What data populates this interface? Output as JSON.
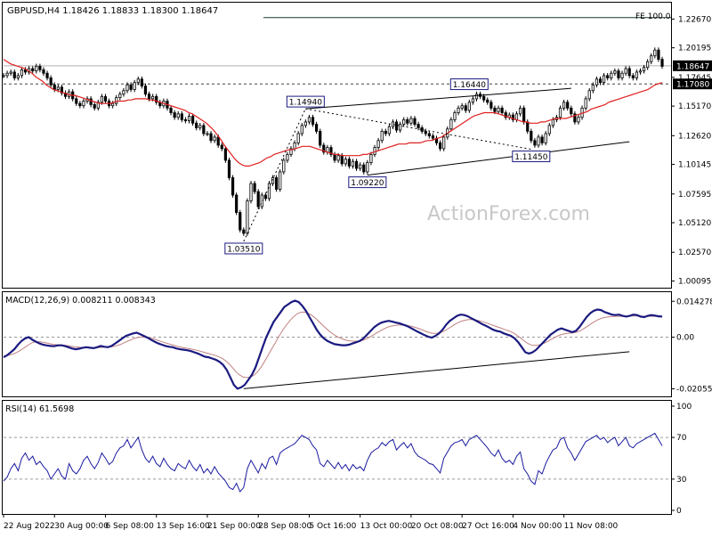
{
  "chart_data": {
    "type": "candlestick",
    "header": "GBPUSD,H4  1.18426 1.18833 1.18300 1.18647",
    "watermark": "ActionForex.com",
    "fe_label": "FE 100.0",
    "price_axis": {
      "ticks": [
        "1.22670",
        "1.20195",
        "1.17645",
        "1.15170",
        "1.12620",
        "1.10145",
        "1.07595",
        "1.05120",
        "1.02570",
        "1.00095"
      ],
      "tick_values": [
        1.2267,
        1.20195,
        1.17645,
        1.1517,
        1.1262,
        1.10145,
        1.07595,
        1.0512,
        1.0257,
        1.00095
      ],
      "current_price_label": "1.18647",
      "current_price": 1.18647,
      "support_label": "1.17080",
      "support_price": 1.1708,
      "fe_level": 1.228,
      "ylim": [
        0.999,
        1.237
      ]
    },
    "annotations": [
      {
        "label": "1.03510",
        "price": 1.0351,
        "bar": 66
      },
      {
        "label": "1.14940",
        "price": 1.1494,
        "bar": 83
      },
      {
        "label": "1.09220",
        "price": 1.0922,
        "bar": 100
      },
      {
        "label": "1.16440",
        "price": 1.1644,
        "bar": 128
      },
      {
        "label": "1.11450",
        "price": 1.1145,
        "bar": 145
      }
    ],
    "x_axis": {
      "labels": [
        "22 Aug 2022",
        "30 Aug 00:00",
        "6 Sep 08:00",
        "13 Sep 16:00",
        "21 Sep 00:00",
        "28 Sep 08:00",
        "5 Oct 16:00",
        "13 Oct 00:00",
        "20 Oct 08:00",
        "27 Oct 16:00",
        "4 Nov 00:00",
        "11 Nov 08:00"
      ],
      "label_bars": [
        0,
        14,
        28,
        42,
        56,
        70,
        84,
        98,
        112,
        126,
        140,
        154
      ]
    },
    "candles_close": [
      1.178,
      1.18,
      1.181,
      1.176,
      1.178,
      1.183,
      1.181,
      1.184,
      1.182,
      1.186,
      1.183,
      1.18,
      1.176,
      1.17,
      1.166,
      1.168,
      1.163,
      1.16,
      1.164,
      1.158,
      1.154,
      1.152,
      1.156,
      1.158,
      1.153,
      1.15,
      1.155,
      1.16,
      1.156,
      1.152,
      1.154,
      1.159,
      1.162,
      1.165,
      1.17,
      1.166,
      1.172,
      1.175,
      1.169,
      1.162,
      1.158,
      1.16,
      1.155,
      1.152,
      1.156,
      1.15,
      1.146,
      1.142,
      1.145,
      1.14,
      1.139,
      1.143,
      1.137,
      1.133,
      1.135,
      1.128,
      1.128,
      1.122,
      1.125,
      1.118,
      1.115,
      1.105,
      1.09,
      1.075,
      1.06,
      1.045,
      1.042,
      1.07,
      1.085,
      1.078,
      1.065,
      1.075,
      1.072,
      1.085,
      1.09,
      1.08,
      1.095,
      1.105,
      1.11,
      1.115,
      1.12,
      1.128,
      1.135,
      1.138,
      1.142,
      1.136,
      1.13,
      1.118,
      1.112,
      1.116,
      1.11,
      1.105,
      1.109,
      1.102,
      1.106,
      1.1,
      1.104,
      1.098,
      1.101,
      1.095,
      1.103,
      1.11,
      1.116,
      1.122,
      1.13,
      1.128,
      1.134,
      1.138,
      1.131,
      1.136,
      1.14,
      1.137,
      1.141,
      1.136,
      1.133,
      1.13,
      1.128,
      1.126,
      1.124,
      1.12,
      1.115,
      1.125,
      1.132,
      1.14,
      1.146,
      1.15,
      1.152,
      1.148,
      1.155,
      1.158,
      1.162,
      1.16,
      1.157,
      1.155,
      1.15,
      1.147,
      1.15,
      1.146,
      1.142,
      1.144,
      1.14,
      1.145,
      1.15,
      1.138,
      1.13,
      1.122,
      1.118,
      1.125,
      1.12,
      1.128,
      1.135,
      1.14,
      1.142,
      1.15,
      1.155,
      1.15,
      1.145,
      1.138,
      1.142,
      1.15,
      1.158,
      1.165,
      1.17,
      1.175,
      1.172,
      1.178,
      1.176,
      1.18,
      1.182,
      1.176,
      1.18,
      1.184,
      1.178,
      1.176,
      1.181,
      1.182,
      1.185,
      1.19,
      1.195,
      1.2,
      1.192,
      1.186
    ],
    "ma_close": [
      1.192,
      1.19,
      1.188,
      1.187,
      1.186,
      1.185,
      1.184,
      1.182,
      1.18,
      1.177,
      1.175,
      1.173,
      1.17,
      1.168,
      1.166,
      1.165,
      1.164,
      1.163,
      1.162,
      1.161,
      1.161,
      1.16,
      1.159,
      1.158,
      1.157,
      1.156,
      1.155,
      1.154,
      1.154,
      1.154,
      1.154,
      1.155,
      1.156,
      1.156,
      1.156,
      1.157,
      1.157,
      1.158,
      1.158,
      1.158,
      1.158,
      1.157,
      1.157,
      1.156,
      1.155,
      1.154,
      1.153,
      1.152,
      1.151,
      1.15,
      1.149,
      1.148,
      1.146,
      1.145,
      1.143,
      1.141,
      1.139,
      1.137,
      1.134,
      1.131,
      1.127,
      1.123,
      1.118,
      1.114,
      1.11,
      1.106,
      1.103,
      1.101,
      1.1,
      1.1,
      1.101,
      1.102,
      1.103,
      1.105,
      1.107,
      1.108,
      1.11,
      1.111,
      1.112,
      1.113,
      1.114,
      1.114,
      1.115,
      1.116,
      1.117,
      1.117,
      1.117,
      1.116,
      1.115,
      1.114,
      1.113,
      1.112,
      1.111,
      1.11,
      1.11,
      1.109,
      1.109,
      1.109,
      1.109,
      1.109,
      1.109,
      1.11,
      1.11,
      1.111,
      1.112,
      1.113,
      1.114,
      1.115,
      1.116,
      1.117,
      1.118,
      1.119,
      1.119,
      1.119,
      1.12,
      1.12,
      1.12,
      1.12,
      1.121,
      1.122,
      1.122,
      1.123,
      1.124,
      1.125,
      1.127,
      1.129,
      1.131,
      1.133,
      1.135,
      1.137,
      1.139,
      1.141,
      1.143,
      1.144,
      1.145,
      1.146,
      1.146,
      1.146,
      1.146,
      1.145,
      1.144,
      1.143,
      1.142,
      1.141,
      1.14,
      1.139,
      1.138,
      1.138,
      1.137,
      1.137,
      1.137,
      1.138,
      1.138,
      1.139,
      1.14,
      1.141,
      1.141,
      1.141,
      1.141,
      1.142,
      1.143,
      1.144,
      1.145,
      1.146,
      1.147,
      1.149,
      1.15,
      1.151,
      1.152,
      1.153,
      1.155,
      1.156,
      1.157,
      1.158,
      1.159,
      1.16,
      1.161,
      1.162,
      1.163,
      1.164,
      1.165,
      1.166,
      1.168,
      1.17,
      1.171,
      1.172
    ],
    "trendlines": [
      {
        "name": "channel-upper",
        "from": {
          "bar": 83,
          "price": 1.1494
        },
        "to": {
          "bar": 156,
          "price": 1.167
        }
      },
      {
        "name": "channel-lower",
        "from": {
          "bar": 100,
          "price": 1.0922
        },
        "to": {
          "bar": 172,
          "price": 1.121
        }
      },
      {
        "name": "retrace-dotted-1",
        "from": {
          "bar": 83,
          "price": 1.1494
        },
        "to": {
          "bar": 145,
          "price": 1.1145
        },
        "dashed": true
      },
      {
        "name": "retrace-dotted-2",
        "from": {
          "bar": 66,
          "price": 1.0351
        },
        "to": {
          "bar": 83,
          "price": 1.1494
        },
        "dashed": true
      }
    ],
    "macd": {
      "label": "MACD(12,26,9) 0.008211 0.008343",
      "ticks": [
        "0.014278",
        "0.00",
        "-0.020556"
      ],
      "tick_values": [
        0.014278,
        0.0,
        -0.020556
      ],
      "ylim": [
        -0.0225,
        0.0165
      ],
      "macd_line": [
        -0.008,
        -0.0072,
        -0.006,
        -0.0048,
        -0.003,
        -0.0015,
        -0.0005,
        0.0,
        -0.001,
        -0.0018,
        -0.0025,
        -0.003,
        -0.0033,
        -0.0035,
        -0.0036,
        -0.0033,
        -0.0032,
        -0.0035,
        -0.004,
        -0.0045,
        -0.0048,
        -0.0046,
        -0.0042,
        -0.004,
        -0.0042,
        -0.0044,
        -0.004,
        -0.0035,
        -0.0038,
        -0.004,
        -0.0035,
        -0.0025,
        -0.0015,
        -0.0005,
        0.0005,
        0.001,
        0.0015,
        0.0018,
        0.0012,
        0.0005,
        -0.0002,
        -0.001,
        -0.0018,
        -0.0025,
        -0.003,
        -0.0035,
        -0.0038,
        -0.004,
        -0.0045,
        -0.0048,
        -0.005,
        -0.0052,
        -0.0055,
        -0.006,
        -0.0065,
        -0.0072,
        -0.0078,
        -0.008,
        -0.0085,
        -0.009,
        -0.0098,
        -0.011,
        -0.013,
        -0.016,
        -0.019,
        -0.0205,
        -0.02,
        -0.019,
        -0.017,
        -0.015,
        -0.012,
        -0.008,
        -0.004,
        0.0,
        0.003,
        0.006,
        0.008,
        0.01,
        0.012,
        0.013,
        0.014,
        0.0145,
        0.014,
        0.0125,
        0.0105,
        0.008,
        0.0055,
        0.003,
        0.001,
        -0.0005,
        -0.0015,
        -0.0022,
        -0.0028,
        -0.003,
        -0.0032,
        -0.0032,
        -0.003,
        -0.0025,
        -0.002,
        -0.0015,
        -0.0005,
        0.001,
        0.0025,
        0.004,
        0.005,
        0.0058,
        0.0062,
        0.0065,
        0.0062,
        0.0058,
        0.0055,
        0.005,
        0.0045,
        0.0038,
        0.003,
        0.0022,
        0.0015,
        0.0008,
        0.0002,
        -0.0002,
        0.0005,
        0.0015,
        0.003,
        0.005,
        0.0065,
        0.0075,
        0.0085,
        0.009,
        0.0088,
        0.0083,
        0.0075,
        0.0068,
        0.006,
        0.0052,
        0.0045,
        0.0038,
        0.003,
        0.0025,
        0.0022,
        0.0015,
        0.001,
        0.0005,
        -0.0005,
        -0.002,
        -0.004,
        -0.006,
        -0.0065,
        -0.006,
        -0.005,
        -0.0035,
        -0.002,
        -0.0005,
        0.001,
        0.002,
        0.003,
        0.0035,
        0.003,
        0.0025,
        0.002,
        0.0025,
        0.004,
        0.006,
        0.008,
        0.0095,
        0.0105,
        0.011,
        0.0108,
        0.01,
        0.0095,
        0.009,
        0.0088,
        0.009,
        0.0085,
        0.0082,
        0.0085,
        0.009,
        0.0088,
        0.0082,
        0.008,
        0.0085,
        0.0088,
        0.0086,
        0.0083,
        0.0082
      ],
      "signal_line": [
        -0.0075,
        -0.0074,
        -0.007,
        -0.0065,
        -0.0058,
        -0.005,
        -0.004,
        -0.003,
        -0.0022,
        -0.0018,
        -0.0018,
        -0.002,
        -0.0023,
        -0.0026,
        -0.0029,
        -0.003,
        -0.0031,
        -0.0032,
        -0.0034,
        -0.0036,
        -0.0039,
        -0.004,
        -0.0041,
        -0.0041,
        -0.0041,
        -0.0042,
        -0.0042,
        -0.0041,
        -0.004,
        -0.004,
        -0.0039,
        -0.0036,
        -0.0032,
        -0.0027,
        -0.002,
        -0.0014,
        -0.0008,
        -0.0003,
        0.0,
        0.0001,
        0.0,
        -0.0003,
        -0.0007,
        -0.0012,
        -0.0017,
        -0.0022,
        -0.0026,
        -0.003,
        -0.0034,
        -0.0038,
        -0.0041,
        -0.0044,
        -0.0046,
        -0.0049,
        -0.0052,
        -0.0056,
        -0.006,
        -0.0064,
        -0.0068,
        -0.0072,
        -0.0077,
        -0.0084,
        -0.0093,
        -0.0106,
        -0.0122,
        -0.0139,
        -0.0151,
        -0.0159,
        -0.0161,
        -0.0159,
        -0.0151,
        -0.0137,
        -0.0118,
        -0.0095,
        -0.007,
        -0.0045,
        -0.002,
        0.0005,
        0.0028,
        0.0048,
        0.0066,
        0.0081,
        0.0093,
        0.0099,
        0.01,
        0.0096,
        0.0088,
        0.0077,
        0.0064,
        0.005,
        0.0036,
        0.0024,
        0.0013,
        0.0004,
        -0.0003,
        -0.0009,
        -0.0013,
        -0.0015,
        -0.0016,
        -0.0016,
        -0.0014,
        -0.0009,
        -0.0002,
        0.0006,
        0.0015,
        0.0023,
        0.0031,
        0.0038,
        0.0043,
        0.0046,
        0.0048,
        0.0049,
        0.0048,
        0.0046,
        0.0043,
        0.0039,
        0.0034,
        0.0029,
        0.0023,
        0.0018,
        0.0015,
        0.0015,
        0.0018,
        0.0024,
        0.0032,
        0.0041,
        0.005,
        0.0058,
        0.0064,
        0.0068,
        0.007,
        0.007,
        0.0068,
        0.0065,
        0.0061,
        0.0056,
        0.0051,
        0.0046,
        0.0041,
        0.0036,
        0.0031,
        0.0026,
        0.002,
        0.0012,
        0.0002,
        -0.001,
        -0.0021,
        -0.0029,
        -0.0033,
        -0.0033,
        -0.003,
        -0.0024,
        -0.0017,
        -0.0009,
        -0.0001,
        0.0006,
        0.0011,
        0.0014,
        0.0016,
        0.0017,
        0.002,
        0.0025,
        0.0033,
        0.0042,
        0.0052,
        0.0061,
        0.0069,
        0.0075,
        0.0079,
        0.0081,
        0.0082,
        0.0083,
        0.0083,
        0.0083,
        0.0083,
        0.0084,
        0.0084,
        0.0084,
        0.0083,
        0.0083,
        0.0083,
        0.0083,
        0.0083,
        0.0083,
        0.0083
      ]
    },
    "rsi": {
      "label": "RSI(14) 61.5698",
      "ticks": [
        "100",
        "70",
        "30",
        "0"
      ],
      "tick_values": [
        100,
        70,
        30,
        0
      ],
      "levels": [
        70,
        30
      ],
      "ylim": [
        0,
        100
      ],
      "values": [
        28,
        32,
        40,
        45,
        38,
        50,
        55,
        48,
        52,
        44,
        47,
        42,
        38,
        30,
        35,
        40,
        33,
        30,
        45,
        38,
        35,
        40,
        48,
        52,
        45,
        40,
        46,
        55,
        50,
        44,
        47,
        55,
        60,
        62,
        68,
        60,
        65,
        70,
        58,
        50,
        46,
        52,
        45,
        42,
        50,
        44,
        40,
        38,
        45,
        42,
        40,
        48,
        42,
        38,
        44,
        36,
        40,
        35,
        42,
        36,
        32,
        28,
        22,
        20,
        26,
        18,
        22,
        40,
        48,
        42,
        36,
        45,
        40,
        50,
        52,
        44,
        55,
        58,
        60,
        62,
        64,
        68,
        72,
        70,
        68,
        62,
        58,
        45,
        42,
        48,
        44,
        40,
        46,
        40,
        44,
        38,
        44,
        40,
        42,
        38,
        48,
        55,
        58,
        60,
        65,
        62,
        66,
        68,
        58,
        62,
        65,
        60,
        64,
        56,
        52,
        50,
        48,
        45,
        44,
        40,
        36,
        50,
        56,
        62,
        65,
        66,
        68,
        62,
        68,
        70,
        72,
        68,
        64,
        60,
        55,
        52,
        58,
        50,
        46,
        48,
        44,
        52,
        56,
        40,
        35,
        28,
        25,
        38,
        35,
        45,
        52,
        58,
        60,
        68,
        70,
        60,
        55,
        48,
        54,
        60,
        66,
        68,
        70,
        72,
        68,
        70,
        65,
        68,
        70,
        62,
        66,
        70,
        62,
        60,
        64,
        66,
        68,
        70,
        72,
        74,
        68,
        62
      ]
    }
  }
}
